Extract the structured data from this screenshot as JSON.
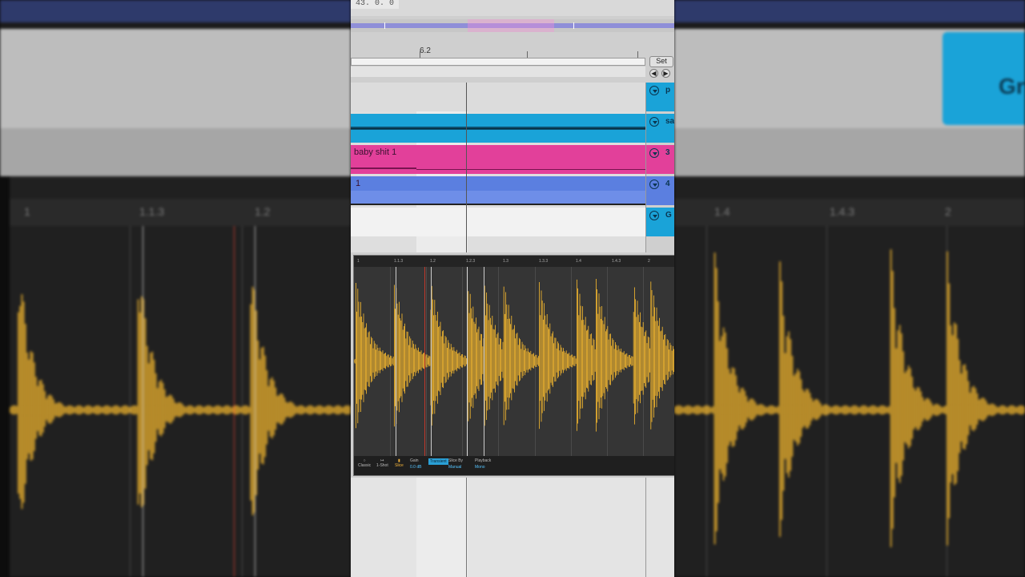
{
  "transport": {
    "position": "43. 0. 0"
  },
  "ruler": {
    "marker": "6.2"
  },
  "loop": {
    "set_label": "Set",
    "prev_icon": "arrow-left-icon",
    "next_icon": "arrow-right-icon"
  },
  "tracks": [
    {
      "clip_label": "",
      "header": "p",
      "color": "#dcdcdc",
      "header_color": "#1aa3d8"
    },
    {
      "clip_label": "",
      "header": "sa",
      "color": "#1aa3d8",
      "header_color": "#1aa3d8"
    },
    {
      "clip_label": "baby shit 1",
      "header": "3",
      "color": "#e2409a",
      "header_color": "#e2409a"
    },
    {
      "clip_label": "1",
      "header": "4",
      "color": "#5b7fe0",
      "header_color": "#5b7fe0"
    },
    {
      "clip_label": "",
      "header": "G",
      "color": "#f2f2f2",
      "header_color": "#1aa3d8"
    }
  ],
  "sampler": {
    "ruler_labels": [
      "1",
      "1.1.3",
      "1.2",
      "1.2.3",
      "1.3",
      "1.3.3",
      "1.4",
      "1.4.3",
      "2"
    ],
    "wave_color": "#f5b82e",
    "controls": {
      "classic": "Classic",
      "one_shot": "1-Shot",
      "slice": "Slice",
      "gain_label": "Gain",
      "gain_value": "0.0 dB",
      "transient_label": "Transient",
      "slice_by_label": "Slice By",
      "slice_by_value": "Manual",
      "playback_label": "Playback",
      "playback_value": "Mono"
    }
  },
  "background": {
    "right_header": "Gr",
    "ruler_left": [
      "1",
      "1.1.3",
      "1.2"
    ],
    "ruler_right": [
      "1.4",
      "1.4.3",
      "2"
    ]
  }
}
